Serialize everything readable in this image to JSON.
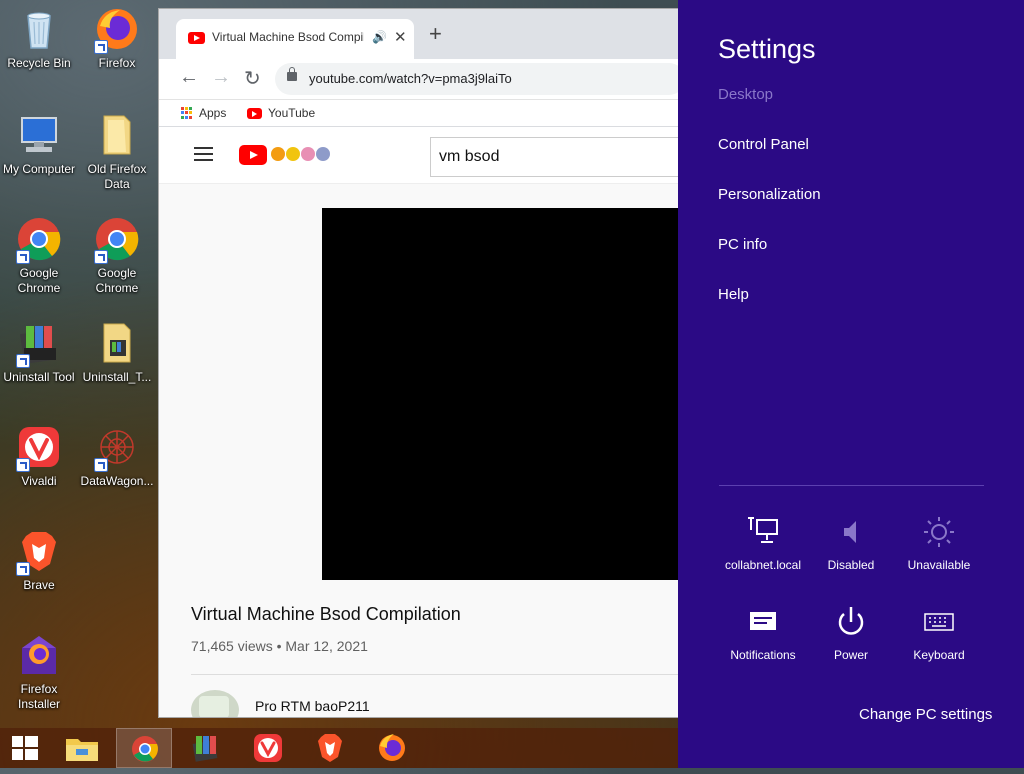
{
  "desktop": {
    "icons": [
      {
        "label": "Recycle Bin"
      },
      {
        "label": "Firefox"
      },
      {
        "label": "My Computer"
      },
      {
        "label": "Old Firefox Data"
      },
      {
        "label": "Google Chrome"
      },
      {
        "label": "Google Chrome"
      },
      {
        "label": "Uninstall Tool"
      },
      {
        "label": "Uninstall_T..."
      },
      {
        "label": "Vivaldi"
      },
      {
        "label": "DataWagon..."
      },
      {
        "label": "Brave"
      },
      {
        "label": "Firefox Installer"
      }
    ]
  },
  "browser": {
    "tab": {
      "title": "Virtual Machine Bsod Compilation",
      "speaker": "🔊",
      "close": "✕"
    },
    "new_tab": "+",
    "nav": {
      "back": "←",
      "forward": "→",
      "reload": "↻"
    },
    "url": "youtube.com/watch?v=pma3j9laiTo",
    "bookmarks": [
      {
        "label": "Apps"
      },
      {
        "label": "YouTube"
      }
    ],
    "colors": {
      "youtube_red": "#ff0000"
    }
  },
  "youtube": {
    "search_query": "vm bsod",
    "video_title": "Virtual Machine Bsod Compilation",
    "video_meta": "71,465 views • Mar 12, 2021",
    "channel_name": "Pro RTM baoP211"
  },
  "settings_charm": {
    "title": "Settings",
    "context": "Desktop",
    "links": [
      {
        "label": "Control Panel"
      },
      {
        "label": "Personalization"
      },
      {
        "label": "PC info"
      },
      {
        "label": "Help"
      }
    ],
    "tiles": [
      {
        "label": "collabnet.local",
        "icon": "network-icon"
      },
      {
        "label": "Disabled",
        "icon": "volume-icon"
      },
      {
        "label": "Unavailable",
        "icon": "brightness-icon"
      },
      {
        "label": "Notifications",
        "icon": "notifications-icon"
      },
      {
        "label": "Power",
        "icon": "power-icon"
      },
      {
        "label": "Keyboard",
        "icon": "keyboard-icon"
      }
    ],
    "change_settings": "Change PC settings",
    "colors": {
      "background": "#2b0a85",
      "dim_text": "#8a77c9"
    }
  },
  "taskbar": {
    "items": [
      {
        "icon": "start-icon"
      },
      {
        "icon": "file-explorer-icon"
      },
      {
        "icon": "chrome-icon",
        "active": true
      },
      {
        "icon": "winrar-icon"
      },
      {
        "icon": "vivaldi-icon"
      },
      {
        "icon": "brave-icon"
      },
      {
        "icon": "firefox-icon"
      }
    ]
  }
}
